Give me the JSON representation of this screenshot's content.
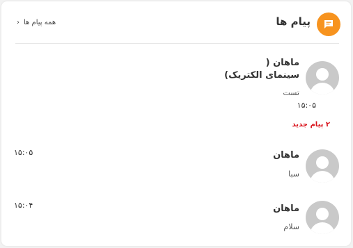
{
  "header": {
    "title": "پیام ها",
    "see_all": "همه پیام ها",
    "icon": "message-icon",
    "accent_color": "#f7931e"
  },
  "messages": [
    {
      "name_line1": "ماهان (",
      "name_line2": "سینمای الکتریک)",
      "preview": "تست",
      "time": "۱۵:۰۵"
    },
    {
      "name_line1": "ماهان",
      "preview": "سبا",
      "time": "۱۵:۰۵"
    },
    {
      "name_line1": "ماهان",
      "preview": "سلام",
      "time": "۱۵:۰۴"
    }
  ],
  "new_messages_label": "۲ پیام جدید",
  "new_messages_color": "#d9121b"
}
